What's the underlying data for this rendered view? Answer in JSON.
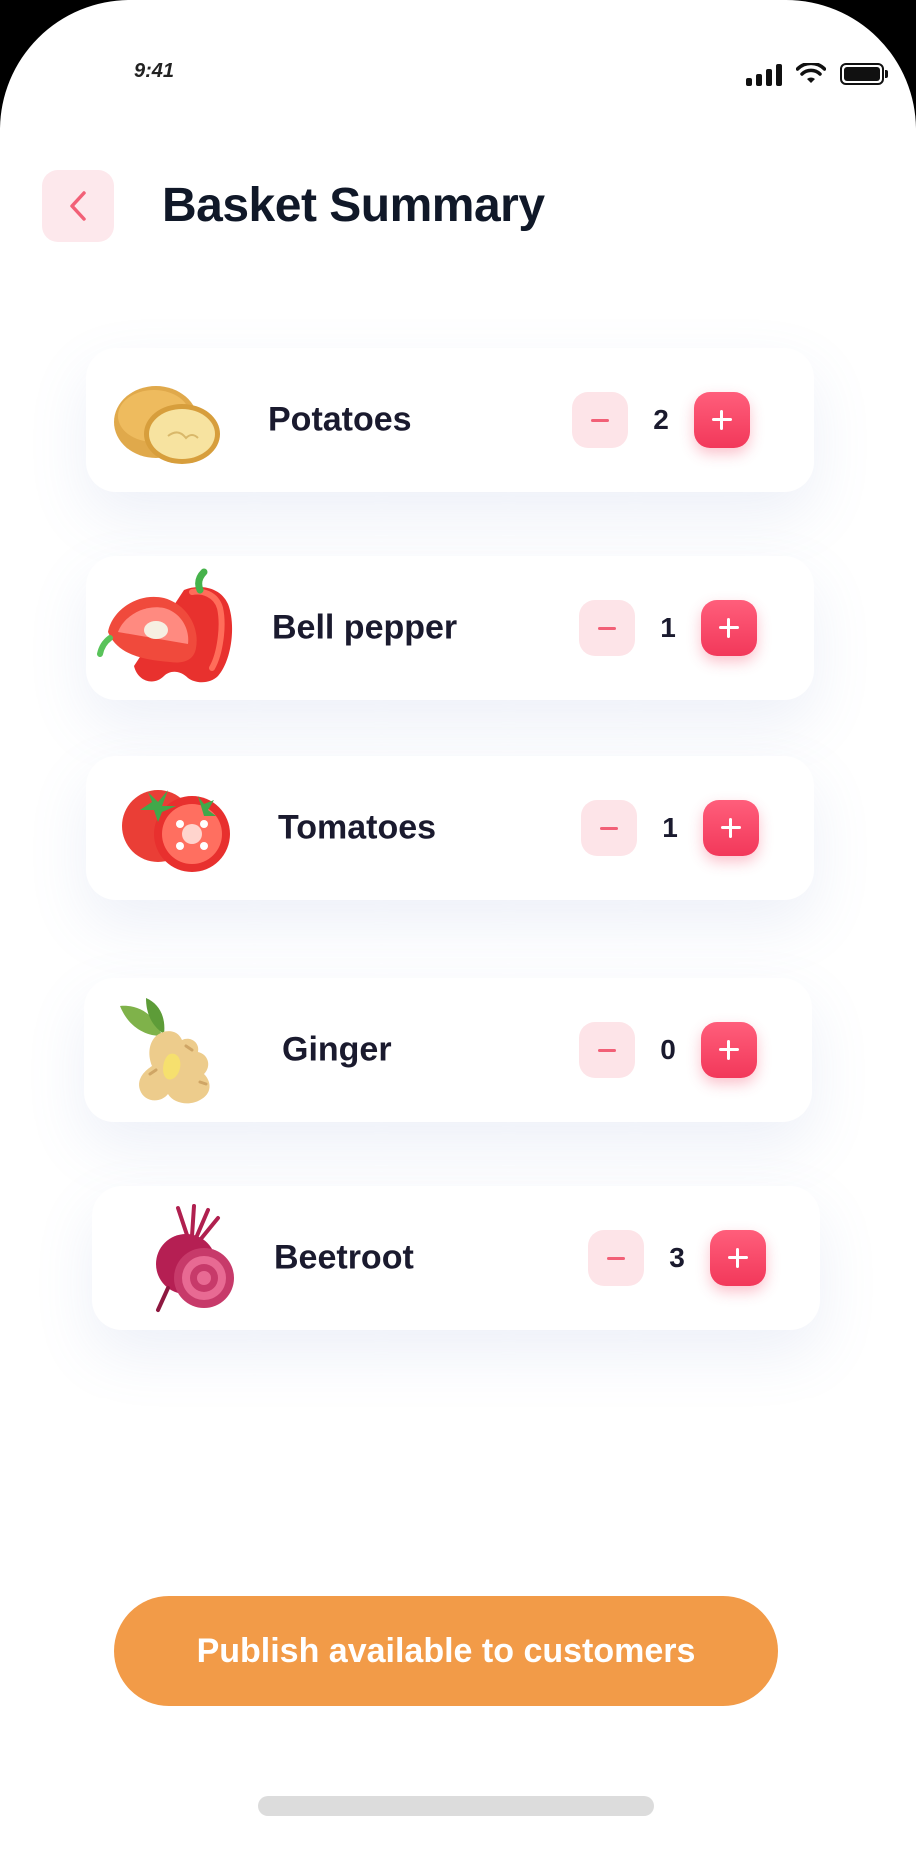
{
  "status_bar": {
    "time": "9:41"
  },
  "header": {
    "title": "Basket Summary"
  },
  "items": [
    {
      "name": "Potatoes",
      "quantity": "2",
      "icon": "potato-icon"
    },
    {
      "name": "Bell pepper",
      "quantity": "1",
      "icon": "bell-pepper-icon"
    },
    {
      "name": "Tomatoes",
      "quantity": "1",
      "icon": "tomato-icon"
    },
    {
      "name": "Ginger",
      "quantity": "0",
      "icon": "ginger-icon"
    },
    {
      "name": "Beetroot",
      "quantity": "3",
      "icon": "beetroot-icon"
    }
  ],
  "footer": {
    "publish_label": "Publish available to customers"
  },
  "colors": {
    "accent": "#F2385A",
    "accent_light": "#FDE4E8",
    "cta": "#F29B48",
    "title": "#101828"
  }
}
